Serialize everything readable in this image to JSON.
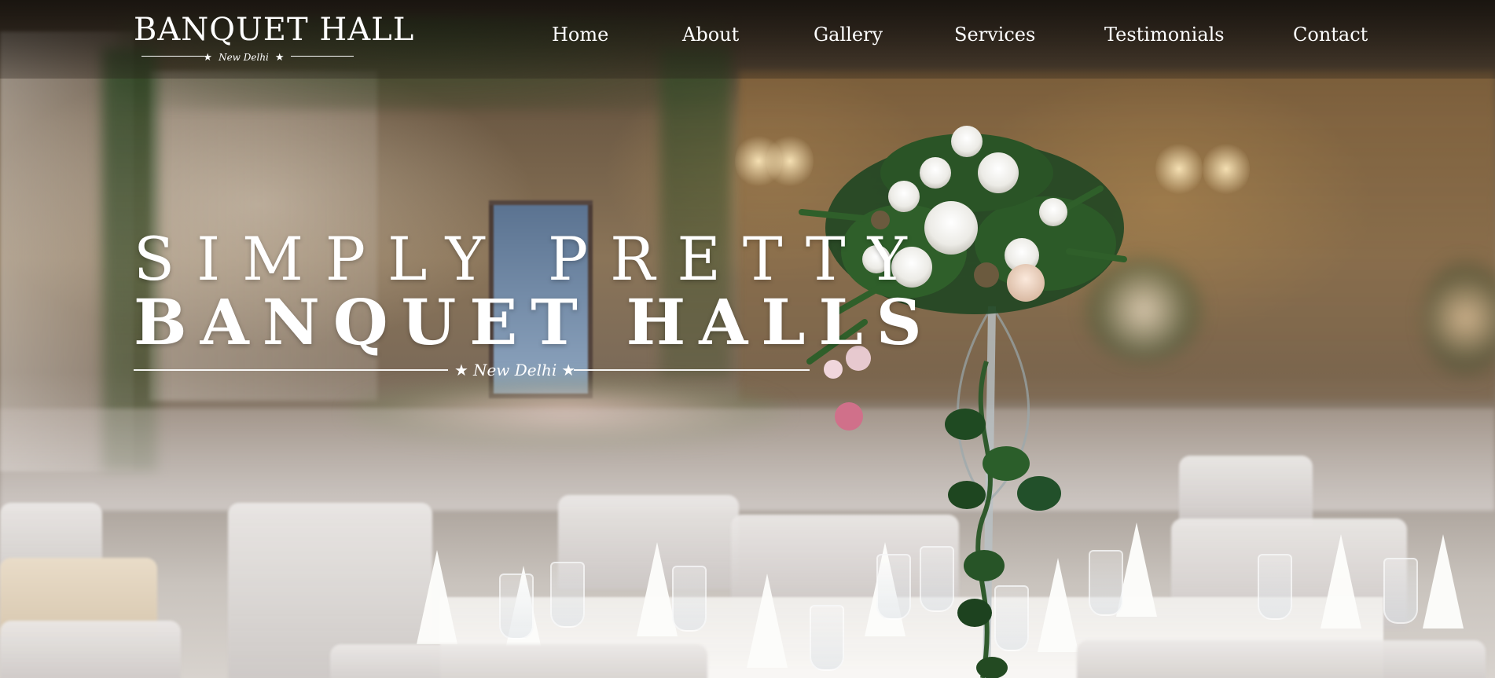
{
  "brand": {
    "title": "BANQUET HALL",
    "location": "New Delhi",
    "star": "★"
  },
  "nav": {
    "items": [
      "Home",
      "About",
      "Gallery",
      "Services",
      "Testimonials",
      "Contact"
    ]
  },
  "hero": {
    "line1": "SIMPLY PRETTY",
    "line2": "BANQUET HALLS",
    "location": "New Delhi",
    "star": "★"
  },
  "background": {
    "image_subject": "banquet-hall-interior-with-floral-centerpiece",
    "text_color": "#ffffff"
  }
}
